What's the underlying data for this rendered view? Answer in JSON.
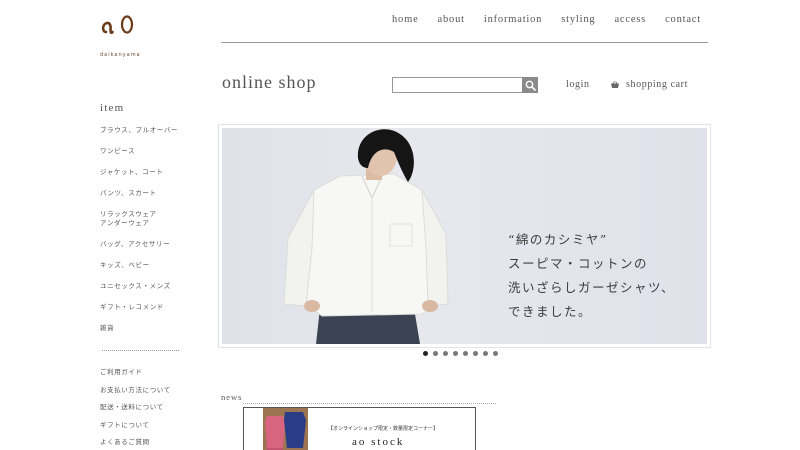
{
  "brand": {
    "logo_text": "ao",
    "tagline": "daikanyama",
    "logo_color": "#6b3b1a"
  },
  "nav": {
    "items": [
      {
        "label": "home"
      },
      {
        "label": "about"
      },
      {
        "label": "information"
      },
      {
        "label": "styling"
      },
      {
        "label": "access"
      },
      {
        "label": "contact"
      }
    ]
  },
  "shop": {
    "title": "online shop",
    "search_placeholder": "",
    "search_icon": "search-icon",
    "login_label": "login",
    "cart_label": "shopping cart",
    "cart_icon": "basket-icon"
  },
  "sidebar": {
    "heading": "item",
    "items": [
      {
        "label": "ブラウス、プルオーバー"
      },
      {
        "label": "ワンピース"
      },
      {
        "label": "ジャケット、コート"
      },
      {
        "label": "パンツ、スカート"
      },
      {
        "label": "リラックスウェア\nアンダーウェア"
      },
      {
        "label": "バッグ、アクセサリー"
      },
      {
        "label": "キッズ、ベビー"
      },
      {
        "label": "ユニセックス・メンズ"
      },
      {
        "label": "ギフト・レコメンド"
      },
      {
        "label": "雑貨"
      }
    ],
    "guide": [
      {
        "label": "ご利用ガイド"
      },
      {
        "label": "お支払い方法について"
      },
      {
        "label": "配送・送料について"
      },
      {
        "label": "ギフトについて"
      },
      {
        "label": "よくあるご質問"
      }
    ]
  },
  "slider": {
    "lines": [
      "“綿のカシミヤ”",
      "スーピマ・コットンの",
      "洗いざらしガーゼシャツ、",
      "できました。"
    ],
    "slide_count": 8,
    "active_index": 0
  },
  "news": {
    "heading": "news",
    "banner_caption": "【オンラインショップ限定・数量限定コーナー】",
    "banner_title": "ao stock"
  }
}
